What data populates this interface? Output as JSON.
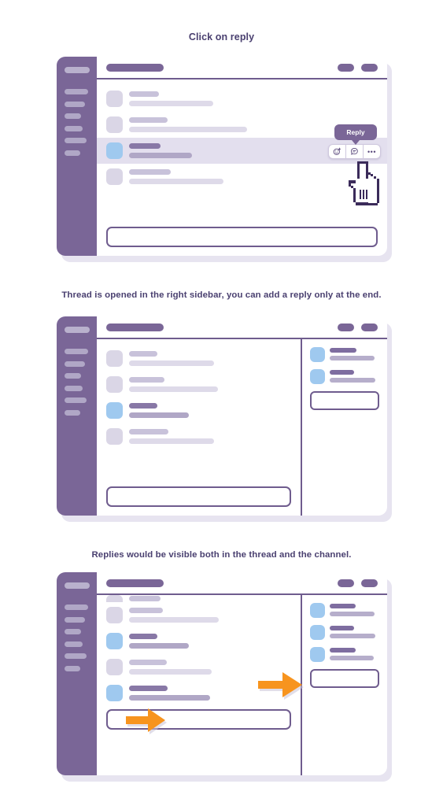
{
  "meta": {
    "title": "Slack thread reply tutorial",
    "colors": {
      "caption_text": "#4A4070",
      "sidebar_purple": "#7A6697",
      "accent_purple": "#6F5C8E",
      "avatar_blue": "#9FC9EF",
      "avatar_gray": "#DAD6E6",
      "arrow_orange": "#F7941E",
      "row_highlight": "#E3DFEE",
      "shadow": "#E7E4F0"
    }
  },
  "steps": [
    {
      "id": "step-1",
      "caption": "Click on reply",
      "window": {
        "rail": {
          "title": "workspace-title",
          "items": [
            "nav-item-1",
            "nav-item-2",
            "nav-item-3",
            "nav-item-4",
            "nav-item-5",
            "nav-item-6"
          ]
        },
        "topbar": {
          "title": "channel-name",
          "actions": [
            "action-pill-1",
            "action-pill-2"
          ]
        },
        "messages": [
          {
            "avatar": "gray",
            "state": "normal"
          },
          {
            "avatar": "gray",
            "state": "normal"
          },
          {
            "avatar": "blue",
            "state": "hovered"
          },
          {
            "avatar": "gray",
            "state": "normal"
          }
        ],
        "composer": "message-input",
        "hover_toolbar": {
          "tooltip": "Reply",
          "buttons": [
            "add-reaction-icon",
            "reply-in-thread-icon",
            "more-actions-icon"
          ]
        },
        "cursor": "pointing-hand-cursor"
      }
    },
    {
      "id": "step-2",
      "caption": "Thread is opened in the right sidebar, you can add a reply only at the end.",
      "window": {
        "rail": {
          "title": "workspace-title",
          "items": [
            "nav-item-1",
            "nav-item-2",
            "nav-item-3",
            "nav-item-4",
            "nav-item-5",
            "nav-item-6"
          ]
        },
        "topbar": {
          "title": "channel-name",
          "actions": [
            "action-pill-1",
            "action-pill-2"
          ]
        },
        "messages": [
          {
            "avatar": "gray",
            "state": "normal"
          },
          {
            "avatar": "gray",
            "state": "normal"
          },
          {
            "avatar": "blue",
            "state": "selected"
          },
          {
            "avatar": "gray",
            "state": "normal"
          }
        ],
        "composer": "message-input",
        "thread": {
          "messages": [
            {
              "avatar": "blue"
            },
            {
              "avatar": "blue"
            }
          ],
          "composer": "thread-reply-input"
        }
      }
    },
    {
      "id": "step-3",
      "caption": "Replies would be visible both in the thread and the channel.",
      "window": {
        "rail": {
          "title": "workspace-title",
          "items": [
            "nav-item-1",
            "nav-item-2",
            "nav-item-3",
            "nav-item-4",
            "nav-item-5",
            "nav-item-6"
          ]
        },
        "topbar": {
          "title": "channel-name",
          "actions": [
            "action-pill-1",
            "action-pill-2"
          ]
        },
        "messages": [
          {
            "avatar": "gray",
            "state": "clipped"
          },
          {
            "avatar": "gray",
            "state": "normal"
          },
          {
            "avatar": "blue",
            "state": "reply"
          },
          {
            "avatar": "gray",
            "state": "normal"
          },
          {
            "avatar": "blue",
            "state": "reply"
          }
        ],
        "composer": "message-input",
        "thread": {
          "messages": [
            {
              "avatar": "blue"
            },
            {
              "avatar": "blue"
            },
            {
              "avatar": "blue"
            }
          ],
          "composer": "thread-reply-input"
        },
        "annotations": [
          {
            "name": "arrow-pointing-to-channel-reply",
            "direction": "right"
          },
          {
            "name": "arrow-pointing-to-thread-reply",
            "direction": "right"
          }
        ]
      }
    }
  ]
}
